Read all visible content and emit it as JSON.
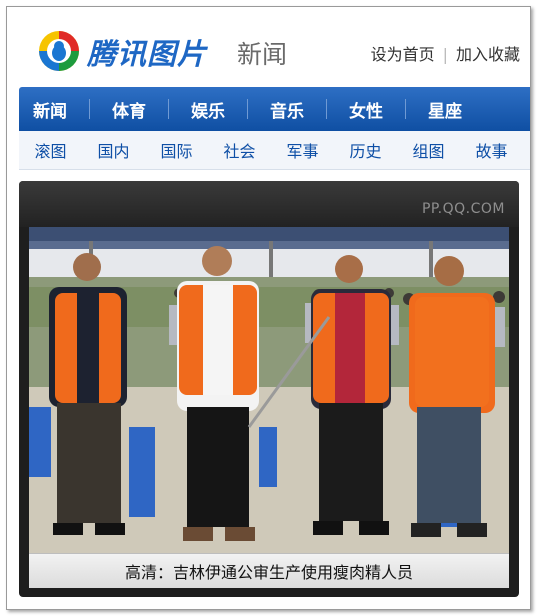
{
  "header": {
    "brand": "腾讯图片",
    "section": "新闻",
    "links": [
      "设为首页",
      "加入收藏"
    ]
  },
  "nav": {
    "main": [
      "新闻",
      "体育",
      "娱乐",
      "音乐",
      "女性",
      "星座"
    ],
    "sub": [
      "滚图",
      "国内",
      "国际",
      "社会",
      "军事",
      "历史",
      "组图",
      "故事"
    ]
  },
  "photo": {
    "watermark": "PP.QQ.COM",
    "caption": "高清：吉林伊通公审生产使用瘦肉精人员"
  },
  "colors": {
    "brand_blue": "#1e67c4",
    "nav_blue": "#0f4fa3",
    "vest_orange": "#f06a1c"
  }
}
